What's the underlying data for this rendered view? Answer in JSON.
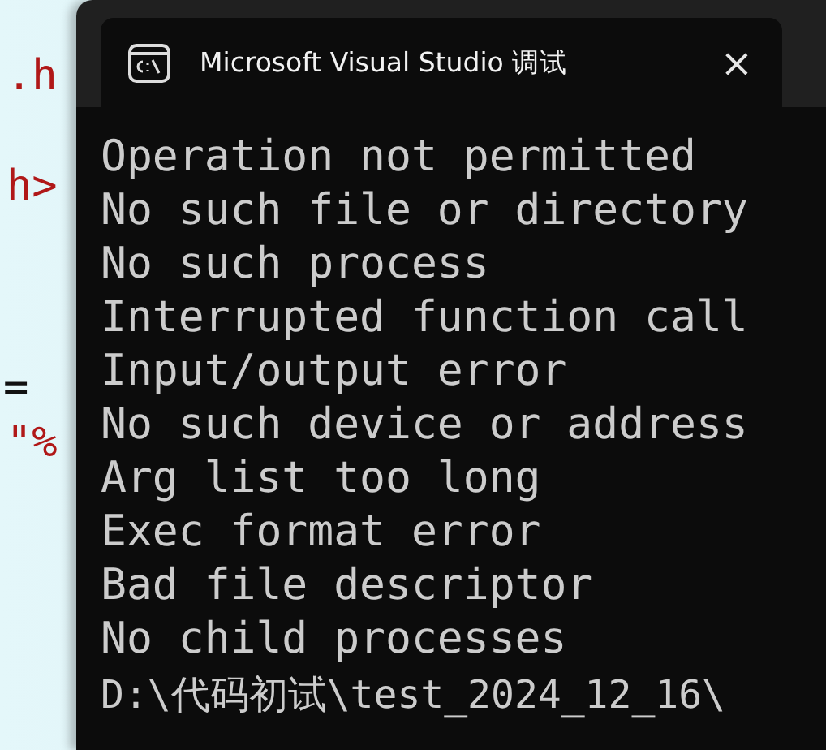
{
  "editor": {
    "top": [
      ".h",
      "h>"
    ],
    "bottom": [
      "=",
      "\"%"
    ]
  },
  "window": {
    "title": "Microsoft Visual Studio 调试",
    "close": "×"
  },
  "console": {
    "lines": [
      "Operation not permitted",
      "No such file or directory",
      "No such process",
      "Interrupted function call",
      "Input/output error",
      "No such device or address",
      "Arg list too long",
      "Exec format error",
      "Bad file descriptor",
      "No child processes"
    ],
    "prompt": "D:\\代码初试\\test_2024_12_16\\"
  }
}
